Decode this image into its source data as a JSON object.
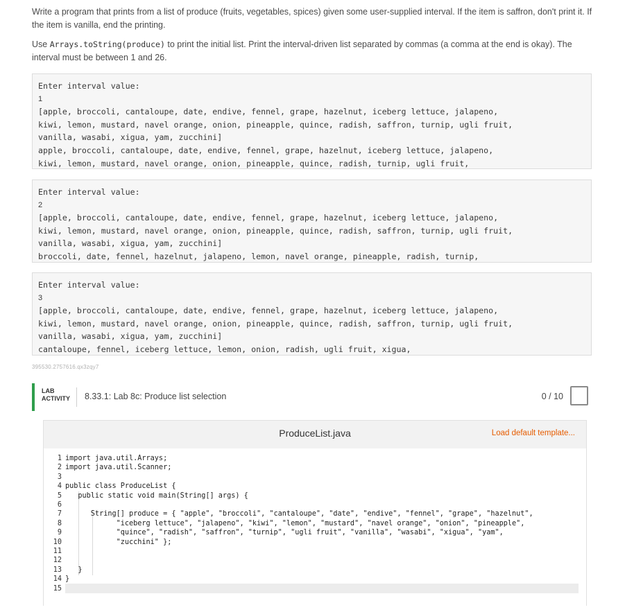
{
  "instructions": {
    "p1": "Write a program that prints from a list of produce (fruits, vegetables, spices) given some user-supplied interval. If the item is saffron, don't print it. If the item is vanilla, end the printing.",
    "p2_before": "Use ",
    "p2_code": "Arrays.toString(produce)",
    "p2_after": " to print the initial list. Print the interval-driven list separated by commas (a comma at the end is okay). The interval must be between 1 and 26."
  },
  "examples": [
    {
      "prompt": "Enter interval value:",
      "input": "1",
      "list": [
        "[apple, broccoli, cantaloupe, date, endive, fennel, grape, hazelnut, iceberg lettuce, jalapeno,",
        "kiwi, lemon, mustard, navel orange, onion, pineapple, quince, radish, saffron, turnip, ugli fruit,",
        "vanilla, wasabi, xigua, yam, zucchini]"
      ],
      "output": [
        "apple, broccoli, cantaloupe, date, endive, fennel, grape, hazelnut, iceberg lettuce, jalapeno,",
        "kiwi, lemon, mustard, navel orange, onion, pineapple, quince, radish, turnip, ugli fruit,"
      ]
    },
    {
      "prompt": "Enter interval value:",
      "input": "2",
      "list": [
        "[apple, broccoli, cantaloupe, date, endive, fennel, grape, hazelnut, iceberg lettuce, jalapeno,",
        "kiwi, lemon, mustard, navel orange, onion, pineapple, quince, radish, saffron, turnip, ugli fruit,",
        "vanilla, wasabi, xigua, yam, zucchini]"
      ],
      "output": [
        "broccoli, date, fennel, hazelnut, jalapeno, lemon, navel orange, pineapple, radish, turnip,"
      ]
    },
    {
      "prompt": "Enter interval value:",
      "input": "3",
      "list": [
        "[apple, broccoli, cantaloupe, date, endive, fennel, grape, hazelnut, iceberg lettuce, jalapeno,",
        "kiwi, lemon, mustard, navel orange, onion, pineapple, quince, radish, saffron, turnip, ugli fruit,",
        "vanilla, wasabi, xigua, yam, zucchini]"
      ],
      "output": [
        "cantaloupe, fennel, iceberg lettuce, lemon, onion, radish, ugli fruit, xigua,"
      ]
    }
  ],
  "tiny_id": "395530.2757616.qx3zqy7",
  "lab": {
    "tag_line1": "LAB",
    "tag_line2": "ACTIVITY",
    "title": "8.33.1: Lab 8c: Produce list selection",
    "score": "0 / 10",
    "accent_color": "#2f9e4c"
  },
  "editor": {
    "file_name": "ProduceList.java",
    "load_template": "Load default template...",
    "line_numbers": [
      "1",
      "2",
      "3",
      "4",
      "5",
      "6",
      "7",
      "8",
      "9",
      "10",
      "11",
      "12",
      "13",
      "14",
      "15"
    ],
    "lines": [
      "import java.util.Arrays;",
      "import java.util.Scanner;",
      "",
      "public class ProduceList {",
      "   public static void main(String[] args) {",
      "",
      "      String[] produce = { \"apple\", \"broccoli\", \"cantaloupe\", \"date\", \"endive\", \"fennel\", \"grape\", \"hazelnut\",",
      "            \"iceberg lettuce\", \"jalapeno\", \"kiwi\", \"lemon\", \"mustard\", \"navel orange\", \"onion\", \"pineapple\",",
      "            \"quince\", \"radish\", \"saffron\", \"turnip\", \"ugli fruit\", \"vanilla\", \"wasabi\", \"xigua\", \"yam\",",
      "            \"zucchini\" };",
      "",
      "",
      "   }",
      "}",
      ""
    ]
  }
}
